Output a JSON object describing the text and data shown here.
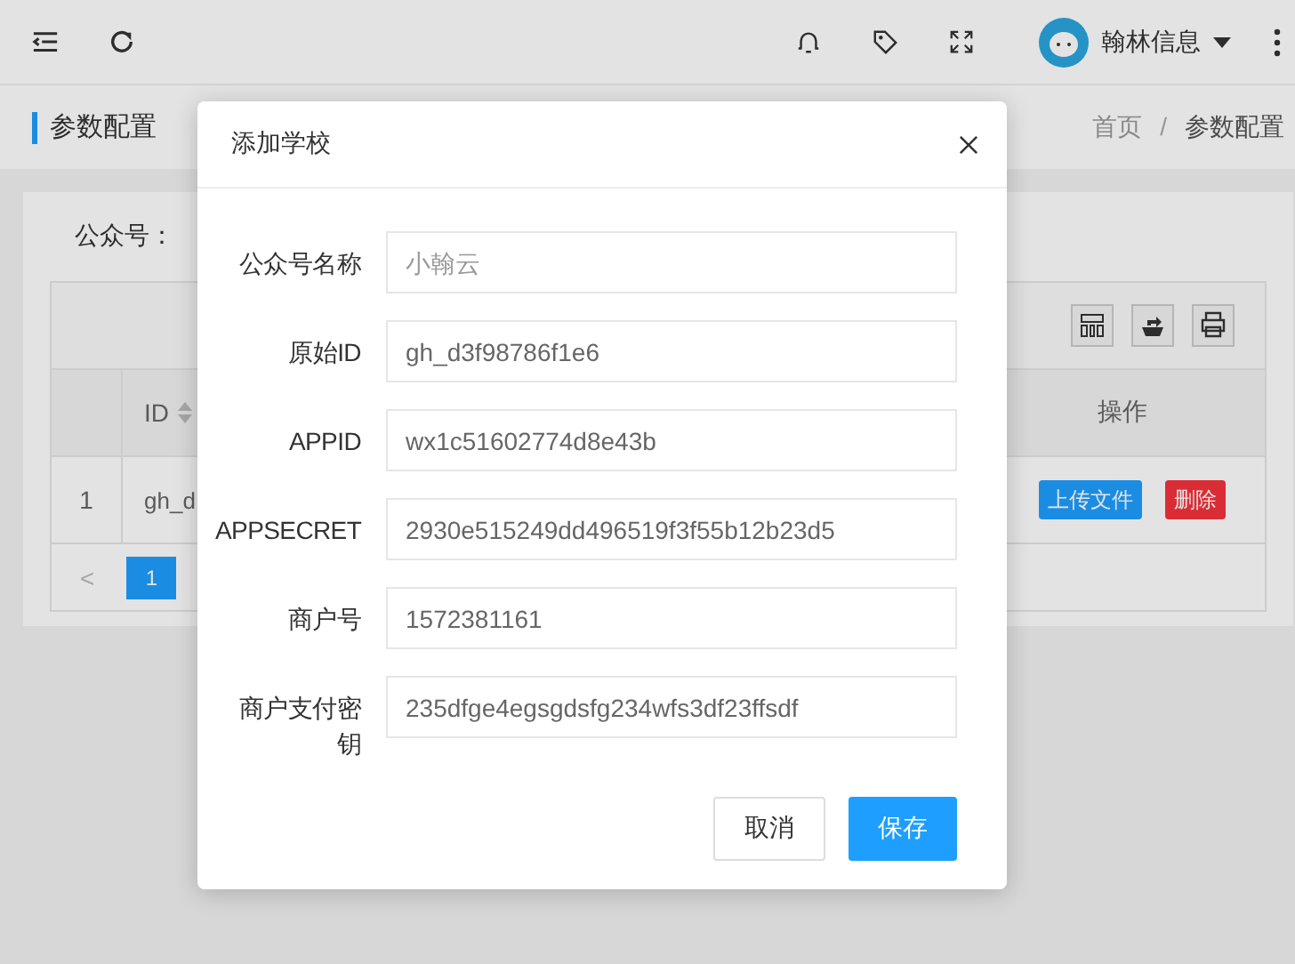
{
  "header": {
    "user_name": "翰林信息"
  },
  "page_title": "参数配置",
  "breadcrumb": [
    {
      "label": "首页",
      "selected": false
    },
    {
      "label": "参数配置",
      "selected": true
    }
  ],
  "breadcrumb_separator": "/",
  "filter": {
    "label": "公众号："
  },
  "table": {
    "columns": [
      {
        "label": "ID",
        "sortable": true
      },
      {
        "label": "操作",
        "sortable": false
      }
    ],
    "rows": [
      {
        "index": "1",
        "id": "gh_d",
        "actions": [
          {
            "label": "上传文件",
            "kind": "primary"
          },
          {
            "label": "删除",
            "kind": "danger"
          }
        ]
      }
    ]
  },
  "pagination": {
    "prev": "<",
    "pages": [
      {
        "label": "1",
        "selected": true
      }
    ]
  },
  "dialog": {
    "title": "添加学校",
    "fields": [
      {
        "label": "公众号名称",
        "placeholder": "小翰云"
      },
      {
        "label": "原始ID",
        "value": "gh_d3f98786f1e6"
      },
      {
        "label": "APPID",
        "value": "wx1c51602774d8e43b"
      },
      {
        "label": "APPSECRET",
        "value": "2930e515249dd496519f3f55b12b23d5"
      },
      {
        "label": "商户号",
        "value": "1572381161"
      },
      {
        "label": "商户支付密钥",
        "value": "235dfge4egsgdsfg234wfs3df23ffsdf"
      }
    ],
    "buttons": [
      {
        "label": "取消",
        "kind": "secondary"
      },
      {
        "label": "保存",
        "kind": "primary"
      }
    ]
  }
}
